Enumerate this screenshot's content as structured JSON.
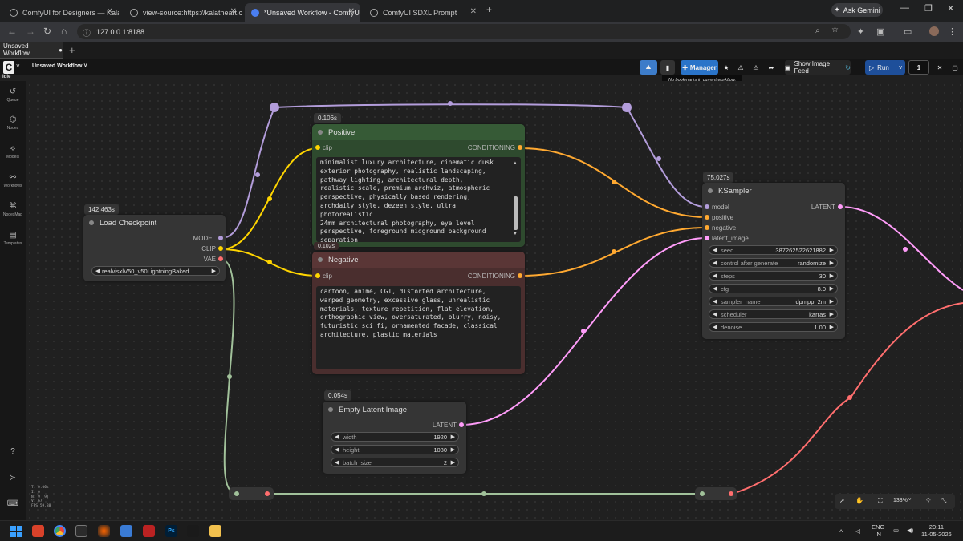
{
  "browser": {
    "tabs": [
      {
        "title": "ComfyUI for Designers — Kala",
        "active": false
      },
      {
        "title": "view-source:https://kalatheart.c",
        "active": false
      },
      {
        "title": "*Unsaved Workflow - ComfyUI",
        "active": true
      },
      {
        "title": "ComfyUI SDXL Prompt",
        "active": false
      }
    ],
    "new_tab": "+",
    "gemini_label": "Ask Gemini",
    "url": "127.0.0.1:8188"
  },
  "comfy": {
    "workflow_tab": "Unsaved Workflow",
    "workflow_tab_dot": "●",
    "workflow_menu": "Unsaved Workflow ˅",
    "status": "Idle",
    "toolbar": {
      "manager_label": "Manager",
      "show_image_feed": "Show Image Feed",
      "run_label": "Run",
      "run_count": "1"
    },
    "tooltip": "No bookmarks in current workflow.",
    "sidebar": [
      {
        "label": "Queue",
        "icon": "history-icon"
      },
      {
        "label": "Nodes",
        "icon": "nodes-icon"
      },
      {
        "label": "Models",
        "icon": "models-icon"
      },
      {
        "label": "Workflows",
        "icon": "workflows-icon"
      },
      {
        "label": "NodesMap",
        "icon": "nodesmap-icon"
      },
      {
        "label": "Templates",
        "icon": "templates-icon"
      }
    ],
    "stats": [
      "T: 0.00s",
      "I: 0",
      "N: 9 [9]",
      "V: 67",
      "FPS:59.88"
    ],
    "zoom": "133%"
  },
  "nodes": {
    "load_checkpoint": {
      "timing": "142.463s",
      "title": "Load Checkpoint",
      "outputs": [
        "MODEL",
        "CLIP",
        "VAE"
      ],
      "ckpt_name": "realvisxlV50_v50LightningBaked ..."
    },
    "positive": {
      "timing": "0.106s",
      "title": "Positive",
      "input": "clip",
      "output": "CONDITIONING",
      "text": "minimalist luxury architecture, cinematic dusk\nexterior photography, realistic landscaping,\npathway lighting, architectural depth,\nrealistic scale, premium archviz, atmospheric\nperspective, physically based rendering,\narchdaily style, dezeen style, ultra\nphotorealistic\n24mm architectural photography, eye level\nperspective, foreground midground background\nseparation"
    },
    "negative": {
      "timing": "0.102s",
      "title": "Negative",
      "input": "clip",
      "output": "CONDITIONING",
      "text": "cartoon, anime, CGI, distorted architecture,\nwarped geometry, excessive glass, unrealistic\nmaterials, texture repetition, flat elevation,\northographic view, oversaturated, blurry, noisy,\nfuturistic sci fi, ornamented facade, classical\narchitecture, plastic materials"
    },
    "empty_latent": {
      "timing": "0.054s",
      "title": "Empty Latent Image",
      "output": "LATENT",
      "widgets": [
        {
          "name": "width",
          "value": "1920"
        },
        {
          "name": "height",
          "value": "1080"
        },
        {
          "name": "batch_size",
          "value": "2"
        }
      ]
    },
    "ksampler": {
      "timing": "75.027s",
      "title": "KSampler",
      "inputs": [
        "model",
        "positive",
        "negative",
        "latent_image"
      ],
      "output": "LATENT",
      "widgets": [
        {
          "name": "seed",
          "value": "387262522621882"
        },
        {
          "name": "control after generate",
          "value": "randomize"
        },
        {
          "name": "steps",
          "value": "30"
        },
        {
          "name": "cfg",
          "value": "8.0"
        },
        {
          "name": "sampler_name",
          "value": "dpmpp_2m"
        },
        {
          "name": "scheduler",
          "value": "karras"
        },
        {
          "name": "denoise",
          "value": "1.00"
        }
      ]
    }
  },
  "colors": {
    "model_link": "#b39ddb",
    "clip_link": "#ffd500",
    "conditioning_link": "#ffa931",
    "latent_link": "#ff9cf9",
    "vae_link": "#ff6e6e",
    "vae_reroute_link": "#a1c19a",
    "positive_header": "#2b4a2b",
    "negative_header": "#4a2b2b",
    "run_button": "#2d6cdf"
  },
  "taskbar": {
    "lang": "ENG",
    "region": "IN",
    "time": "20:11",
    "date": "11-05-2026"
  }
}
